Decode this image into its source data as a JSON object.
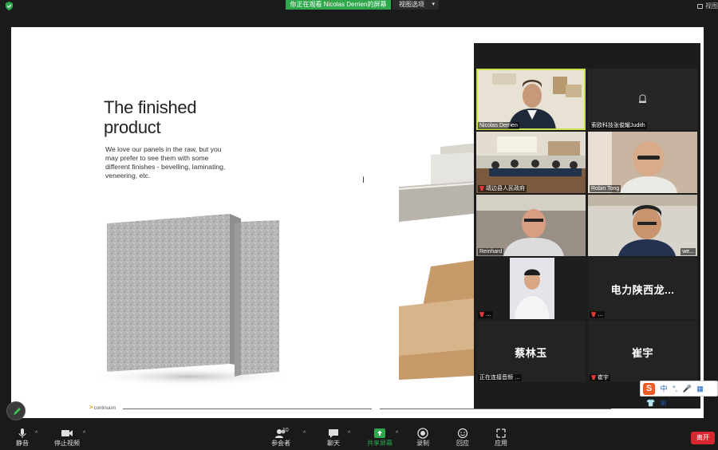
{
  "top": {
    "share_notice": "你正在观看 Nicolas Derrien的屏幕",
    "view_options": "视图选项",
    "view_label": "视图"
  },
  "slide": {
    "title_line1": "The finished",
    "title_line2": "product",
    "body": "We love our panels in the raw, but you may prefer to see them with some different finishes - bevelling, laminating, veneering, etc.",
    "brand": "continuum",
    "brand2": "continuum"
  },
  "gallery": {
    "tiles": [
      {
        "name": "Nicolas Derrien",
        "active": true,
        "muted": false
      },
      {
        "name": "索欧科技张俊耀Judith",
        "muted": false
      },
      {
        "name": "靖边县人民政府",
        "muted": true
      },
      {
        "name": "Robin Tong",
        "muted": false
      },
      {
        "name": "Reinhard",
        "muted": false
      },
      {
        "name": "we...",
        "muted": true
      },
      {
        "name": "…",
        "muted": true
      },
      {
        "name": "…",
        "muted": true,
        "big": "电力陕西龙..."
      },
      {
        "name": "正在连接音频 …",
        "muted": false,
        "big": "蔡林玉"
      },
      {
        "name": "崔宇",
        "muted": true,
        "big": "崔宇"
      }
    ]
  },
  "ime": {
    "logo": "S",
    "items": [
      "中",
      "°,",
      "🎤",
      "▦",
      "👕",
      "⊞"
    ]
  },
  "toolbar": {
    "mute": "静音",
    "video": "停止视频",
    "participants": "参会者",
    "participants_count": "10",
    "chat": "聊天",
    "share": "共享屏幕",
    "record": "录制",
    "reactions": "回应",
    "apps": "应用",
    "leave": "离开"
  },
  "colors": {
    "share_green": "#2ea84a",
    "leave_red": "#d8262f",
    "active_speaker": "#c9e24a"
  }
}
